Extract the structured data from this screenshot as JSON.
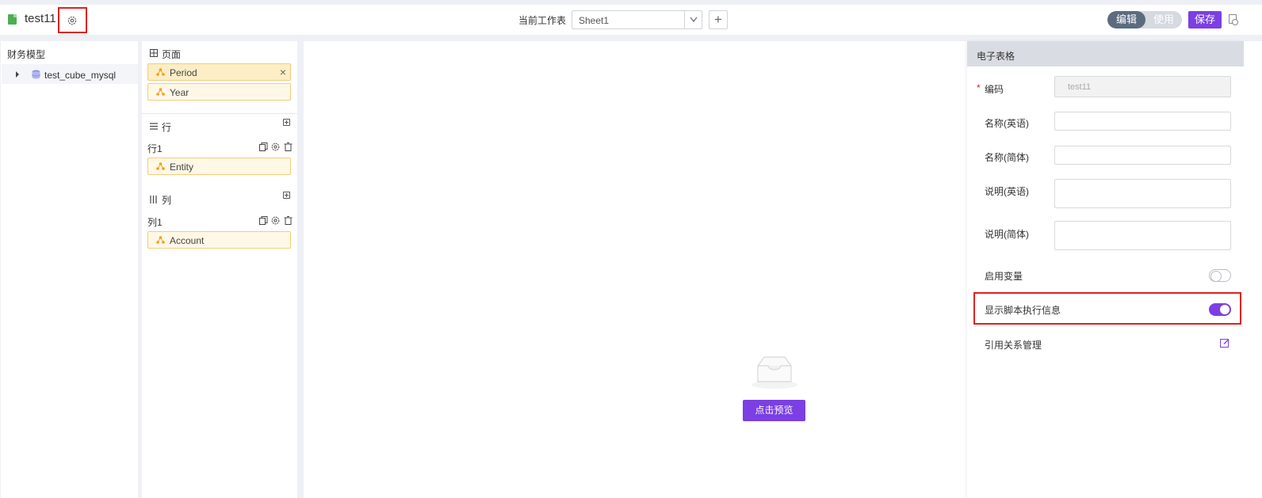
{
  "topbar": {
    "title": "test11",
    "worksheet_label": "当前工作表",
    "worksheet_value": "Sheet1",
    "add_sheet_label": "+",
    "mode_edit": "编辑",
    "mode_use": "使用",
    "save_label": "保存"
  },
  "model_panel": {
    "header": "财务模型",
    "tree_item": "test_cube_mysql"
  },
  "dims_panel": {
    "page_section": "页面",
    "page_chips": [
      "Period",
      "Year"
    ],
    "row_section": "行",
    "row_group": "行1",
    "row_chips": [
      "Entity"
    ],
    "col_section": "列",
    "col_group": "列1",
    "col_chips": [
      "Account"
    ],
    "close_glyph": "×"
  },
  "canvas": {
    "preview_label": "点击预览"
  },
  "props": {
    "header": "电子表格",
    "required_mark": "*",
    "code_label": "编码",
    "code_value": "test11",
    "name_en_label": "名称(英语)",
    "name_zh_label": "名称(简体)",
    "desc_en_label": "说明(英语)",
    "desc_zh_label": "说明(简体)",
    "enable_var_label": "启用变量",
    "enable_var_on": false,
    "show_script_label": "显示脚本执行信息",
    "show_script_on": true,
    "ref_mgmt_label": "引用关系管理"
  },
  "colors": {
    "accent": "#7b3fe4",
    "highlight": "#e02020",
    "chip_bg": "#fff8e6",
    "chip_border": "#f5cc7a"
  }
}
